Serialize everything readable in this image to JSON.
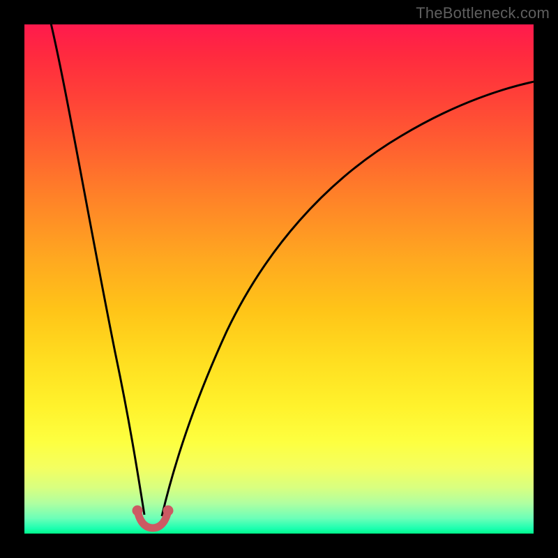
{
  "watermark": "TheBottleneck.com",
  "chart_data": {
    "type": "line",
    "title": "",
    "xlabel": "",
    "ylabel": "",
    "xlim": [
      0,
      100
    ],
    "ylim": [
      0,
      100
    ],
    "notes": "Two black curves descending into a narrow trough and diverging; red marker highlights the minimum region near x≈24.",
    "series": [
      {
        "name": "left-curve",
        "x": [
          5,
          8,
          11,
          14,
          17,
          19,
          21,
          22.5,
          24
        ],
        "y": [
          100,
          80,
          60,
          42,
          26,
          15,
          7,
          3,
          1
        ]
      },
      {
        "name": "right-curve",
        "x": [
          27,
          29,
          32,
          36,
          42,
          50,
          60,
          72,
          86,
          100
        ],
        "y": [
          2,
          6,
          14,
          26,
          40,
          53,
          64,
          74,
          82,
          88
        ]
      },
      {
        "name": "trough-marker",
        "x": [
          22,
          23,
          24,
          25,
          26,
          27
        ],
        "y": [
          4,
          1.5,
          0.8,
          0.8,
          1.5,
          4
        ],
        "color": "#cc5a63"
      }
    ]
  }
}
